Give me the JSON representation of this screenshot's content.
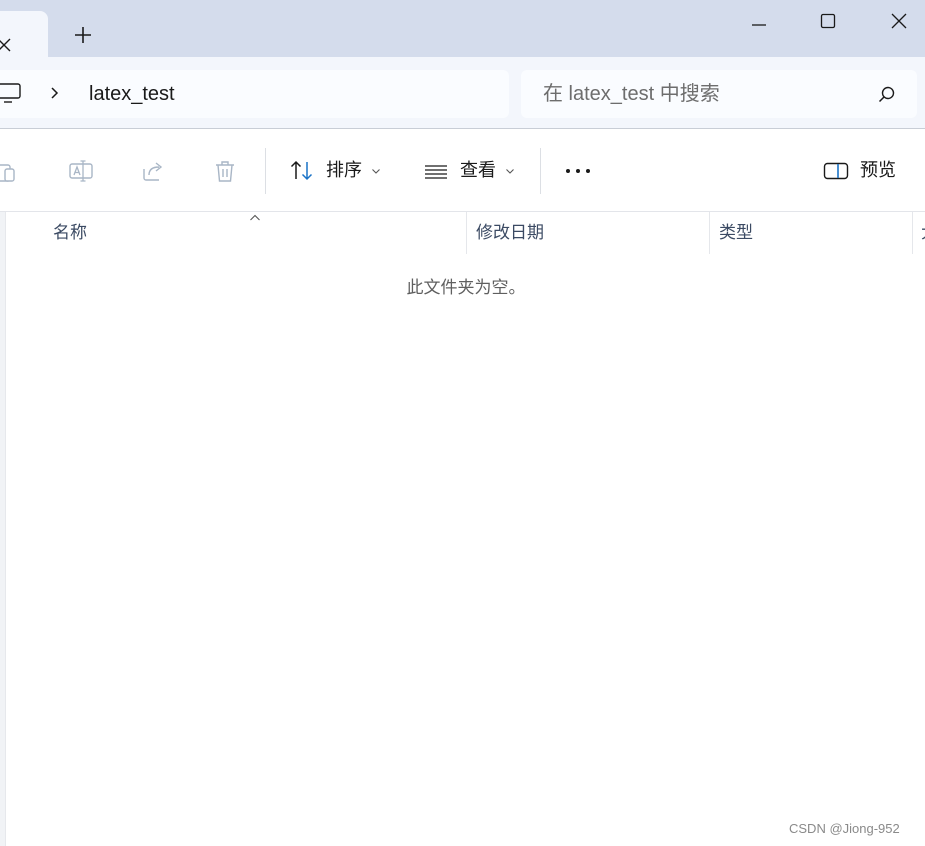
{
  "window": {
    "new_tab_symbol": "+"
  },
  "address": {
    "breadcrumb_label": "latex_test",
    "search_placeholder": "在 latex_test 中搜索"
  },
  "commands": {
    "sort_label": "排序",
    "view_label": "查看",
    "more_symbol": "•••",
    "preview_label": "预览"
  },
  "columns": [
    {
      "label": "名称"
    },
    {
      "label": "修改日期"
    },
    {
      "label": "类型"
    },
    {
      "label": "大"
    }
  ],
  "content": {
    "empty_message": "此文件夹为空。"
  },
  "watermark": "CSDN @Jiong-952",
  "colors": {
    "titlebar": "#d4dcec",
    "accent": "#1a73c7"
  }
}
